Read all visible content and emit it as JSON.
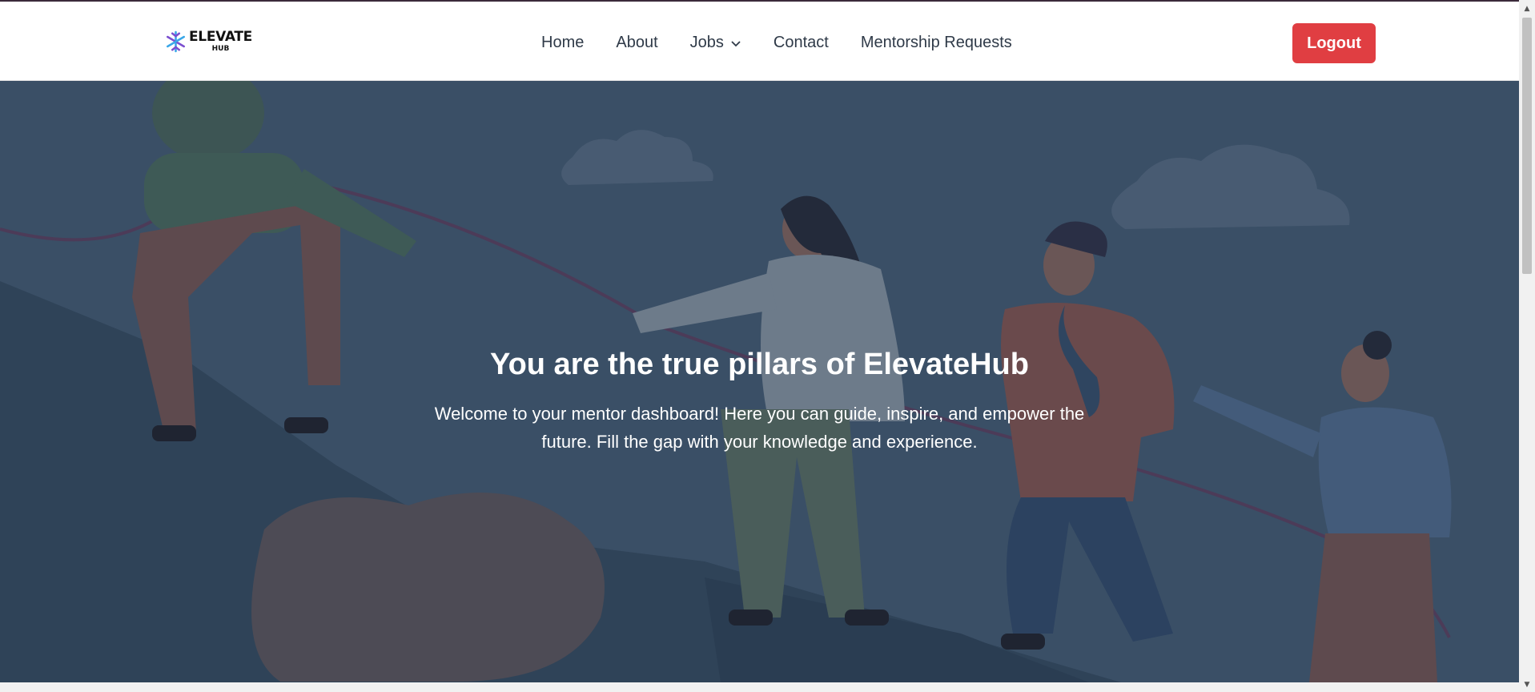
{
  "brand": {
    "name": "ELEVATE",
    "sub": "HUB",
    "logo_icon": "snowflake-logo-icon",
    "colors": {
      "accent": "#e03e42",
      "logo_blue": "#3aa7e8",
      "logo_purple": "#7b4fd0"
    }
  },
  "nav": {
    "items": [
      {
        "label": "Home"
      },
      {
        "label": "About"
      },
      {
        "label": "Jobs",
        "icon": "chevron-down-icon"
      },
      {
        "label": "Contact"
      },
      {
        "label": "Mentorship Requests"
      }
    ],
    "logout_label": "Logout"
  },
  "hero": {
    "title": "You are the true pillars of ElevateHub",
    "text": "Welcome to your mentor dashboard! Here you can guide, inspire, and empower the future. Fill the gap with your knowledge and experience.",
    "overlay_color": "#3a4f66"
  }
}
